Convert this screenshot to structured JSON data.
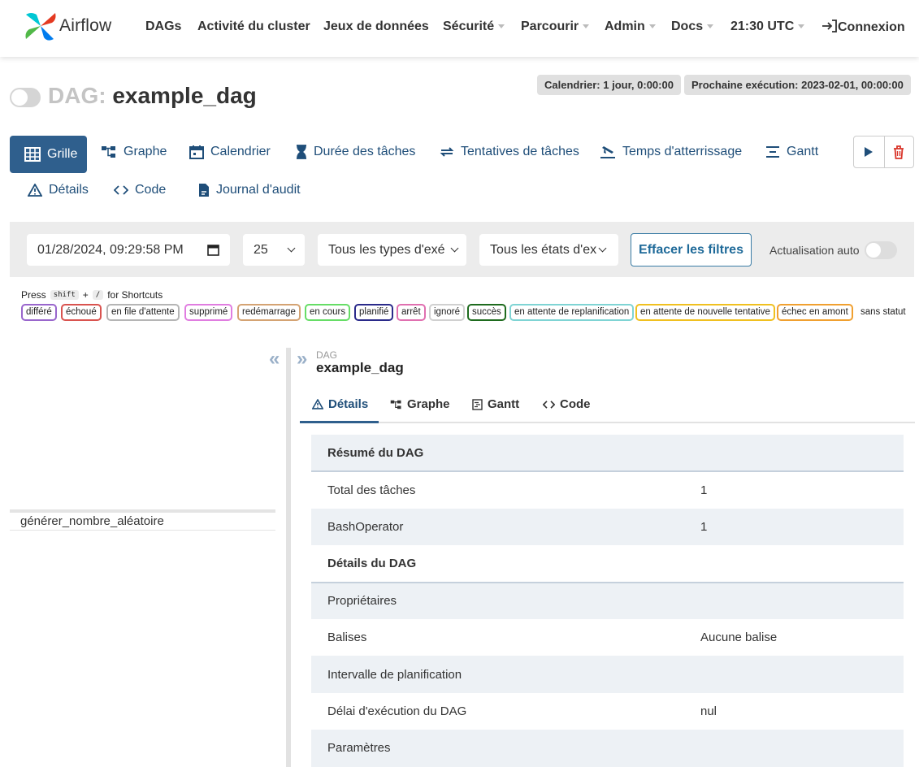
{
  "navbar": {
    "brand": "Airflow",
    "items": [
      {
        "label": "DAGs",
        "dropdown": false
      },
      {
        "label": "Activité du cluster",
        "dropdown": false
      },
      {
        "label": "Jeux de données",
        "dropdown": false
      },
      {
        "label": "Sécurité",
        "dropdown": true
      },
      {
        "label": "Parcourir",
        "dropdown": true
      },
      {
        "label": "Admin",
        "dropdown": true
      },
      {
        "label": "Docs",
        "dropdown": true
      },
      {
        "label": "21:30 UTC",
        "dropdown": true
      }
    ],
    "login": "Connexion"
  },
  "header": {
    "prefix": "DAG:",
    "dag_id": "example_dag",
    "schedule": "Calendrier: 1 jour, 0:00:00",
    "next_run": "Prochaine exécution: 2023-02-01, 00:00:00"
  },
  "view_tabs": [
    {
      "label": "Grille",
      "icon": "grid-icon",
      "active": true
    },
    {
      "label": "Graphe",
      "icon": "graph-icon",
      "active": false
    },
    {
      "label": "Calendrier",
      "icon": "calendar-icon",
      "active": false
    },
    {
      "label": "Durée des tâches",
      "icon": "hourglass-icon",
      "active": false
    },
    {
      "label": "Tentatives de tâches",
      "icon": "retry-icon",
      "active": false
    },
    {
      "label": "Temps d'atterrissage",
      "icon": "landing-icon",
      "active": false
    },
    {
      "label": "Gantt",
      "icon": "gantt-icon",
      "active": false
    },
    {
      "label": "Détails",
      "icon": "warning-icon",
      "active": false
    },
    {
      "label": "Code",
      "icon": "code-icon",
      "active": false
    },
    {
      "label": "Journal d'audit",
      "icon": "audit-log-icon",
      "active": false
    }
  ],
  "filters": {
    "execution_date": "01/28/2024, 09:29:58 PM",
    "num_runs": "25",
    "run_type": "Tous les types d'exé",
    "run_state": "Tous les états d'ex",
    "clear_label": "Effacer les filtres",
    "auto_refresh_label": "Actualisation auto"
  },
  "shortcuts": {
    "press": "Press",
    "key1": "shift",
    "plus": "+",
    "key2": "/",
    "suffix": "for Shortcuts"
  },
  "legend": [
    {
      "label": "différé",
      "color": "#9966cc"
    },
    {
      "label": "échoué",
      "color": "#d9534f"
    },
    {
      "label": "en file d'attente",
      "color": "#b5b5b5"
    },
    {
      "label": "supprimé",
      "color": "#e07de0"
    },
    {
      "label": "redémarrage",
      "color": "#d4a373"
    },
    {
      "label": "en cours",
      "color": "#66dd66"
    },
    {
      "label": "planifié",
      "color": "#2a2a8a"
    },
    {
      "label": "arrêt",
      "color": "#e070b0"
    },
    {
      "label": "ignoré",
      "color": "#d0d0d0"
    },
    {
      "label": "succès",
      "color": "#1e6b1e"
    },
    {
      "label": "en attente de replanification",
      "color": "#7fd4d4"
    },
    {
      "label": "en attente de nouvelle tentative",
      "color": "#f0c020"
    },
    {
      "label": "échec en amont",
      "color": "#f0a030"
    },
    {
      "label": "sans statut",
      "color": "transparent"
    }
  ],
  "grid": {
    "tasks": [
      "générer_nombre_aléatoire"
    ]
  },
  "details": {
    "crumb_label": "DAG",
    "crumb_name": "example_dag",
    "tabs": [
      {
        "label": "Détails",
        "icon": "warning-icon"
      },
      {
        "label": "Graphe",
        "icon": "graph-icon"
      },
      {
        "label": "Gantt",
        "icon": "gantt-icon"
      },
      {
        "label": "Code",
        "icon": "code-icon"
      }
    ],
    "rows": [
      {
        "key": "Résumé du DAG",
        "value": "",
        "type": "head"
      },
      {
        "key": "Total des tâches",
        "value": "1",
        "type": "row"
      },
      {
        "key": "BashOperator",
        "value": "1",
        "type": "row"
      },
      {
        "key": "Détails du DAG",
        "value": "",
        "type": "head"
      },
      {
        "key": "Propriétaires",
        "value": "",
        "type": "row"
      },
      {
        "key": "Balises",
        "value": "Aucune balise",
        "type": "row"
      },
      {
        "key": "Intervalle de planification",
        "value": "",
        "type": "row"
      },
      {
        "key": "Délai d'exécution du DAG",
        "value": "nul",
        "type": "row"
      },
      {
        "key": "Paramètres",
        "value": "",
        "type": "row"
      }
    ]
  }
}
